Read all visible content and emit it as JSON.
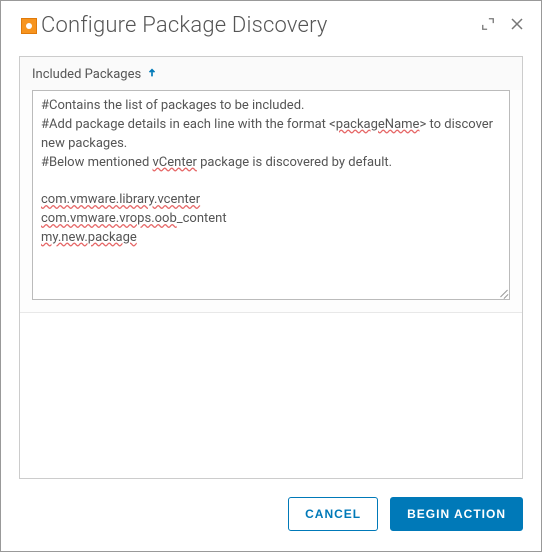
{
  "dialog": {
    "title": "Configure Package Discovery"
  },
  "section": {
    "label": "Included Packages"
  },
  "packages": {
    "comment1": "#Contains the list of packages to be included.",
    "comment2a": "#Add package details in each line with the format <",
    "comment2b": "packageName",
    "comment2c": "> to discover new packages.",
    "comment3a": "#Below mentioned ",
    "comment3b": "vCenter",
    "comment3c": " package is discovered by default.",
    "line1": "com.vmware.library.vcenter",
    "line2a": "com.vmware.vrops.oob",
    "line2b": "_content",
    "line3": "my.new.package"
  },
  "footer": {
    "cancel": "Cancel",
    "begin": "Begin Action"
  }
}
